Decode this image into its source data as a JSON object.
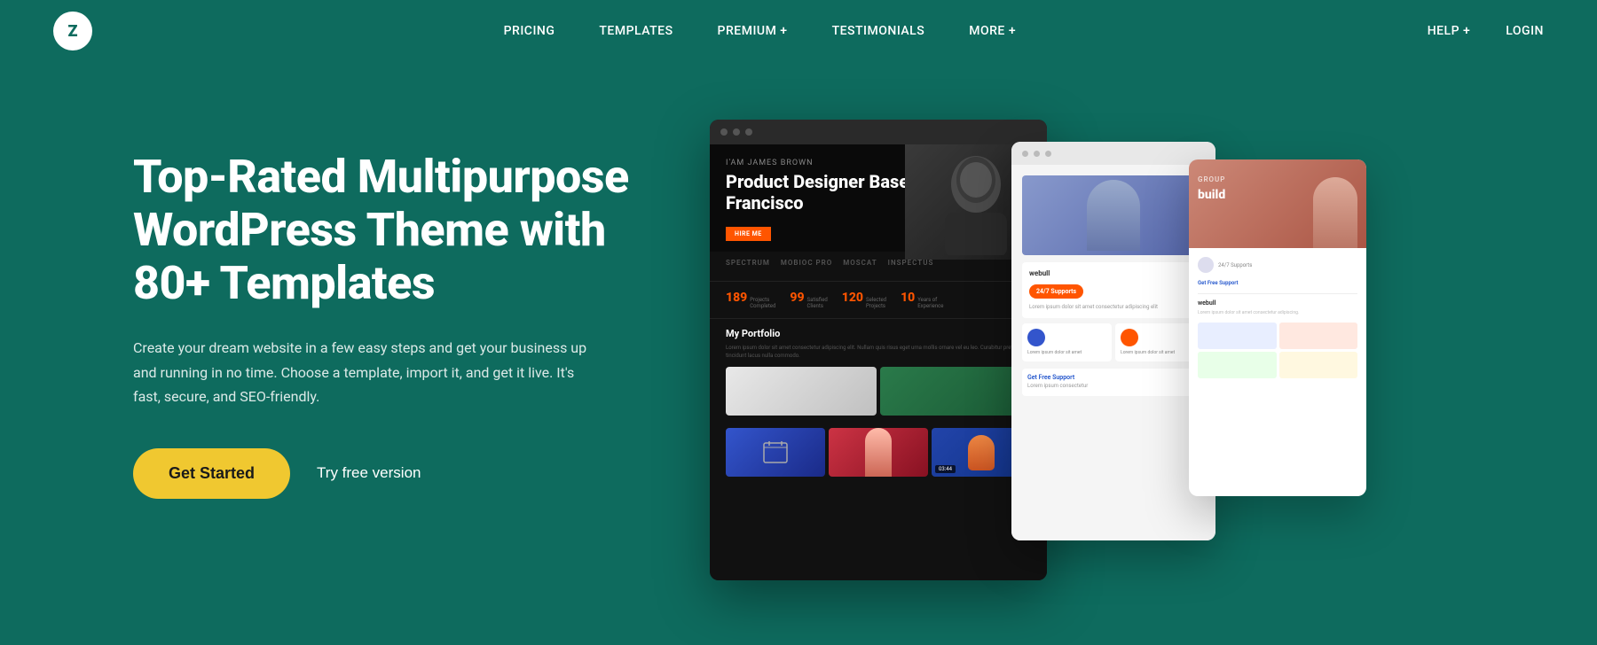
{
  "brand": {
    "logo_letter": "Z",
    "logo_aria": "Zephyr Logo"
  },
  "nav": {
    "center_items": [
      {
        "label": "PRICING",
        "id": "pricing"
      },
      {
        "label": "TEMPLATES",
        "id": "templates"
      },
      {
        "label": "PREMIUM +",
        "id": "premium"
      },
      {
        "label": "TESTIMONIALS",
        "id": "testimonials"
      },
      {
        "label": "MORE +",
        "id": "more"
      }
    ],
    "right_items": [
      {
        "label": "HELP +",
        "id": "help"
      },
      {
        "label": "LOGIN",
        "id": "login"
      }
    ]
  },
  "hero": {
    "title": "Top-Rated Multipurpose WordPress Theme with 80+ Templates",
    "subtitle": "Create your dream website in a few easy steps and get your business up and running in no time. Choose a template, import it, and get it live. It's fast, secure, and SEO-friendly.",
    "cta_primary": "Get Started",
    "cta_secondary": "Try free version"
  },
  "portfolio_preview": {
    "name_label": "I'am James Brown",
    "title": "Product Designer Based in San Francisco",
    "cta_label": "HIRE ME",
    "stats": [
      {
        "num": "189",
        "label": "Projects\nCompleted"
      },
      {
        "num": "99",
        "label": "Satisfied\nClients"
      },
      {
        "num": "120",
        "label": "Selected\nProjects"
      },
      {
        "num": "10",
        "label": "Years of\nExperience"
      }
    ],
    "brands": [
      "SPECTRUM",
      "mOBIOC PRO",
      "MOSCAT",
      "Inspectus"
    ],
    "portfolio_heading": "My Portfolio",
    "video_badge": "03:44",
    "browser_dots": [
      "dot1",
      "dot2",
      "dot3"
    ]
  },
  "secondary_preview": {
    "support_badge": "24/7 Supports",
    "heading": "webull",
    "description": "Lorem ipsum dolor sit amet consectetur adipiscing elit",
    "free_support": "Get Free Support",
    "card1_color": "#3355cc",
    "card2_color": "#ff5500"
  },
  "tertiary_preview": {
    "tag": "Group",
    "heading": "build",
    "support_label": "24/7 Supports",
    "free_text": "Get Free Support",
    "section_heading": "webull",
    "section_text": "Lorem ipsum dolor sit amet consectetur adipiscing."
  },
  "colors": {
    "bg": "#0e6b5e",
    "accent_yellow": "#f0c830",
    "accent_orange": "#ff5500",
    "text_white": "#ffffff"
  }
}
